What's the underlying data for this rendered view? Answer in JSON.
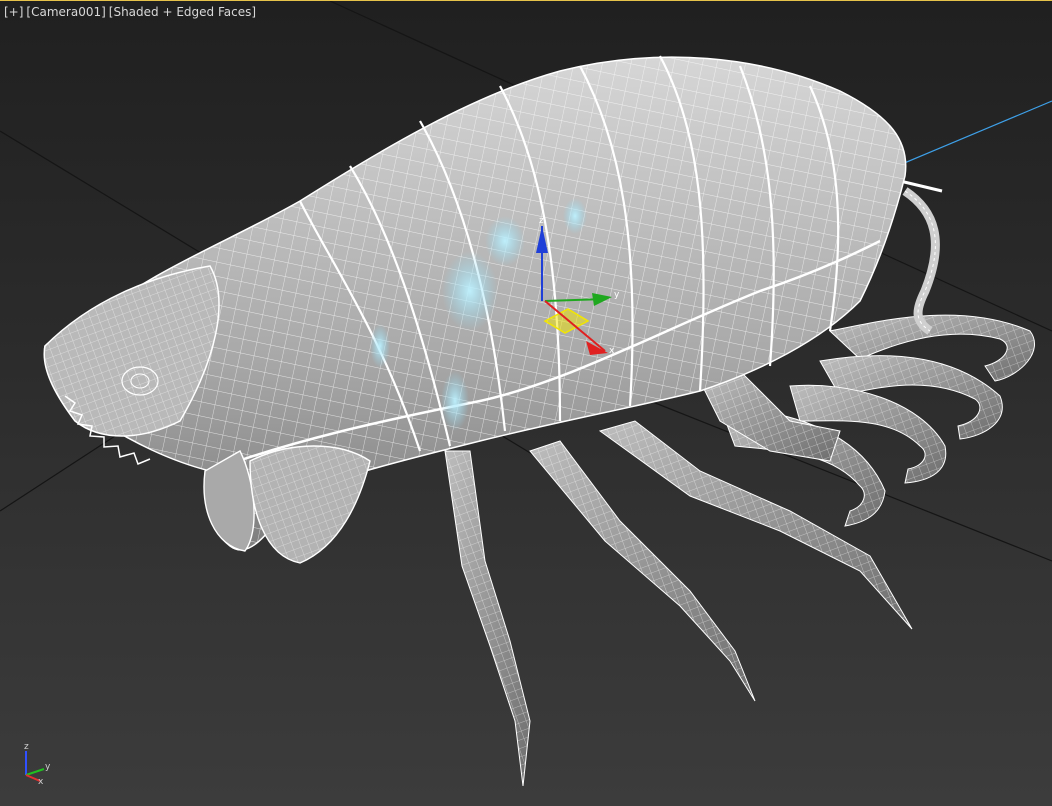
{
  "viewport": {
    "label_plus": "[+]",
    "label_camera": "[Camera001]",
    "label_shading": "[Shaded + Edged Faces]",
    "active_border_color": "#e6c24a",
    "background_top": "#202020",
    "background_bottom": "#3c3c3c"
  },
  "model": {
    "surface_color": "#c9c9c9",
    "highlight_color": "#8fd8f0",
    "wire_color": "#ffffff"
  },
  "gizmo": {
    "z_label": "z",
    "y_label": "y",
    "x_label": "x",
    "z_color": "#1f3fd8",
    "y_color": "#1fa81f",
    "x_color": "#e02020",
    "plane_color": "#f2e600"
  },
  "tripod": {
    "z_label": "z",
    "y_label": "y",
    "x_label": "x"
  },
  "camera_line_color": "#3ea0e8"
}
